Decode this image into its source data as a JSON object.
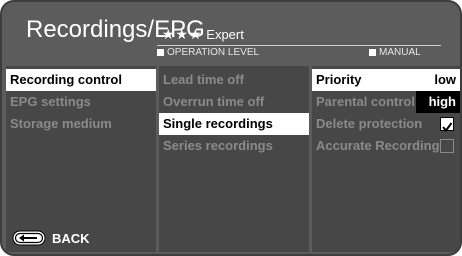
{
  "header": {
    "title": "Recordings/EPG",
    "level_stars": "★★★",
    "level_label": "Expert",
    "operation_level": "OPERATION LEVEL",
    "manual": "MANUAL"
  },
  "left": {
    "items": [
      {
        "label": "Recording control"
      },
      {
        "label": "EPG settings"
      },
      {
        "label": "Storage medium"
      }
    ],
    "back_label": "BACK"
  },
  "middle": {
    "items": [
      {
        "label": "Lead time off"
      },
      {
        "label": "Overrun time off"
      },
      {
        "label": "Single recordings"
      },
      {
        "label": "Series recordings"
      }
    ]
  },
  "right": {
    "rows": [
      {
        "label": "Priority",
        "value": "low"
      },
      {
        "label": "Parental control",
        "value": "high"
      },
      {
        "label": "Delete protection",
        "checked": true
      },
      {
        "label": "Accurate Recording",
        "checked": false
      }
    ]
  }
}
